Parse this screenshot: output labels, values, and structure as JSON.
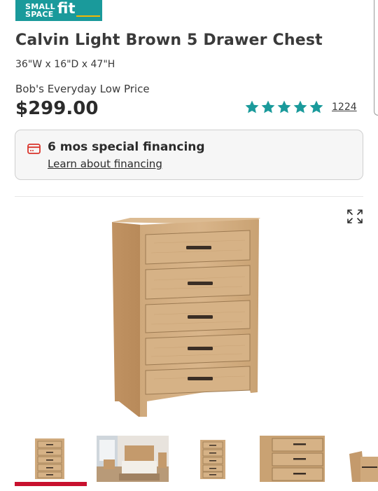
{
  "badge": {
    "line1": "SMALL",
    "line2": "SPACE",
    "suffix": "fit"
  },
  "product": {
    "title": "Calvin Light Brown 5 Drawer Chest",
    "dimensions": "36\"W x 16\"D x 47\"H",
    "price_label": "Bob's Everyday Low Price",
    "price": "$299.00",
    "rating": 5,
    "review_count": "1224"
  },
  "financing": {
    "title": "6 mos special financing",
    "link": "Learn about financing"
  },
  "gallery": {
    "thumbnails": [
      "chest-front",
      "bedroom-scene",
      "chest-small",
      "drawer-closeup",
      "chest-side"
    ],
    "active_index": 0
  },
  "colors": {
    "accent_teal": "#1a9a9b",
    "accent_red": "#c8102e",
    "wood": "#c9a57a"
  }
}
